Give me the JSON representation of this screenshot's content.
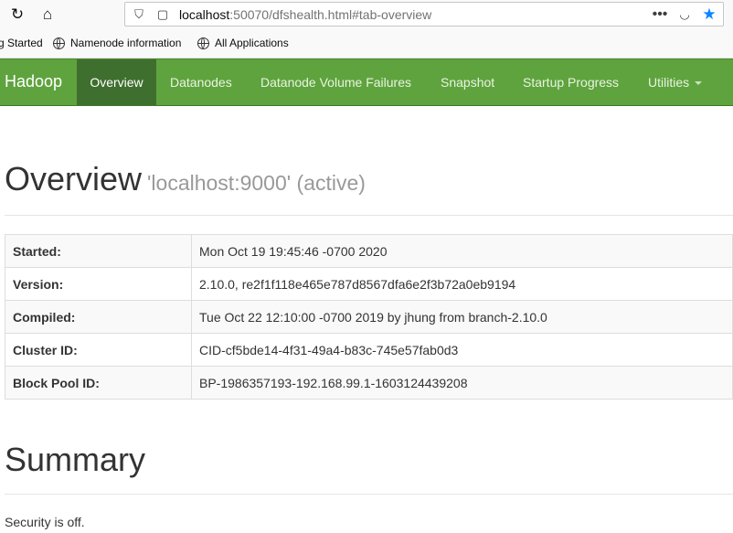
{
  "browser": {
    "url_host": "localhost",
    "url_rest": ":50070/dfshealth.html#tab-overview",
    "bookmarks": [
      "g Started",
      "Namenode information",
      "All Applications"
    ]
  },
  "nav": {
    "brand": "Hadoop",
    "items": [
      "Overview",
      "Datanodes",
      "Datanode Volume Failures",
      "Snapshot",
      "Startup Progress",
      "Utilities"
    ]
  },
  "overview": {
    "title": "Overview",
    "subtitle": "'localhost:9000' (active)",
    "rows": [
      {
        "label": "Started:",
        "value": "Mon Oct 19 19:45:46 -0700 2020"
      },
      {
        "label": "Version:",
        "value": "2.10.0, re2f1f118e465e787d8567dfa6e2f3b72a0eb9194"
      },
      {
        "label": "Compiled:",
        "value": "Tue Oct 22 12:10:00 -0700 2019 by jhung from branch-2.10.0"
      },
      {
        "label": "Cluster ID:",
        "value": "CID-cf5bde14-4f31-49a4-b83c-745e57fab0d3"
      },
      {
        "label": "Block Pool ID:",
        "value": "BP-1986357193-192.168.99.1-1603124439208"
      }
    ]
  },
  "summary": {
    "title": "Summary",
    "security": "Security is off."
  },
  "colors": {
    "navbar": "#5fa33e",
    "navbar_active": "#3f6f2e",
    "bookmark_star": "#0a84ff"
  }
}
